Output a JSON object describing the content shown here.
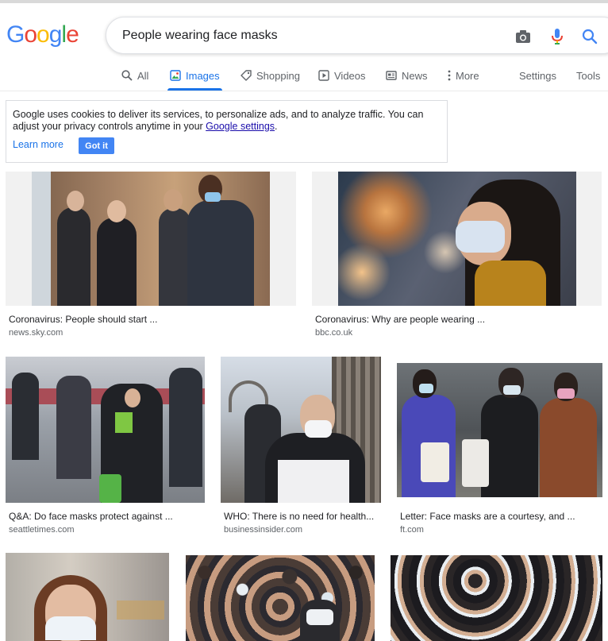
{
  "search": {
    "query": "People wearing face masks",
    "logo_letters": [
      "G",
      "o",
      "o",
      "g",
      "l",
      "e"
    ],
    "logo_colors": [
      "#4285f4",
      "#ea4335",
      "#fbbc05",
      "#4285f4",
      "#34a853",
      "#ea4335"
    ]
  },
  "tabs": {
    "all": "All",
    "images": "Images",
    "shopping": "Shopping",
    "videos": "Videos",
    "news": "News",
    "more": "More",
    "settings": "Settings",
    "tools": "Tools"
  },
  "cookie_notice": {
    "text_1": "Google uses cookies to deliver its services, to personalize ads, and to analyze traffic. You can adjust your privacy controls anytime in your ",
    "settings_link": "Google settings",
    "text_2": ".",
    "learn_more": "Learn more",
    "got_it": "Got it"
  },
  "results": [
    {
      "caption": "Coronavirus: People should start ...",
      "source": "news.sky.com"
    },
    {
      "caption": "Coronavirus: Why are people wearing ...",
      "source": "bbc.co.uk"
    },
    {
      "caption": "Q&A: Do face masks protect against ...",
      "source": "seattletimes.com"
    },
    {
      "caption": "WHO: There is no need for health...",
      "source": "businessinsider.com"
    },
    {
      "caption": "Letter: Face masks are a courtesy, and ...",
      "source": "ft.com"
    }
  ],
  "colors": {
    "accent": "#1a73e8",
    "link": "#1a0dab",
    "muted": "#5f6368"
  }
}
